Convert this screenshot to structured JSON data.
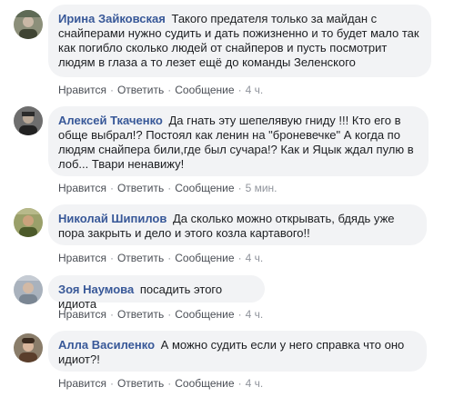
{
  "comments": [
    {
      "author": "Ирина Зайковская",
      "text": "Такого предателя только за майдан с снайперами нужно судить и дать пожизненно и то будет мало так как погибло сколько людей от снайперов и пусть посмотрит людям в глаза а то лезет ещё до команды Зеленского",
      "like": "Нравится",
      "reply": "Ответить",
      "message": "Сообщение",
      "time": "4 ч."
    },
    {
      "author": "Алексей Ткаченко",
      "text": "Да гнать эту шепелявую гниду !!! Кто его в обще выбрал!? Постоял как ленин на \"броневечке\" А когда по людям снайпера били,где был сучара!? Как и Яцык ждал пулю в лоб... Твари ненавижу!",
      "like": "Нравится",
      "reply": "Ответить",
      "message": "Сообщение",
      "time": "5 мин."
    },
    {
      "author": "Николай Шипилов",
      "text": "Да сколько можно открывать, бдядь уже пора закрыть и дело и этого козла картавого!!",
      "like": "Нравится",
      "reply": "Ответить",
      "message": "Сообщение",
      "time": "4 ч."
    },
    {
      "author": "Зоя Наумова",
      "text": "посадить этого идиота",
      "like": "Нравится",
      "reply": "Ответить",
      "message": "Сообщение",
      "time": "4 ч."
    },
    {
      "author": "Алла Василенко",
      "text": "А можно судить если у него справка что оно идиот?!",
      "like": "Нравится",
      "reply": "Ответить",
      "message": "Сообщение",
      "time": "4 ч."
    }
  ],
  "colors": {
    "author": "#385898",
    "bubble": "#f2f3f5",
    "action": "#4b4f56",
    "meta": "#90949c"
  }
}
